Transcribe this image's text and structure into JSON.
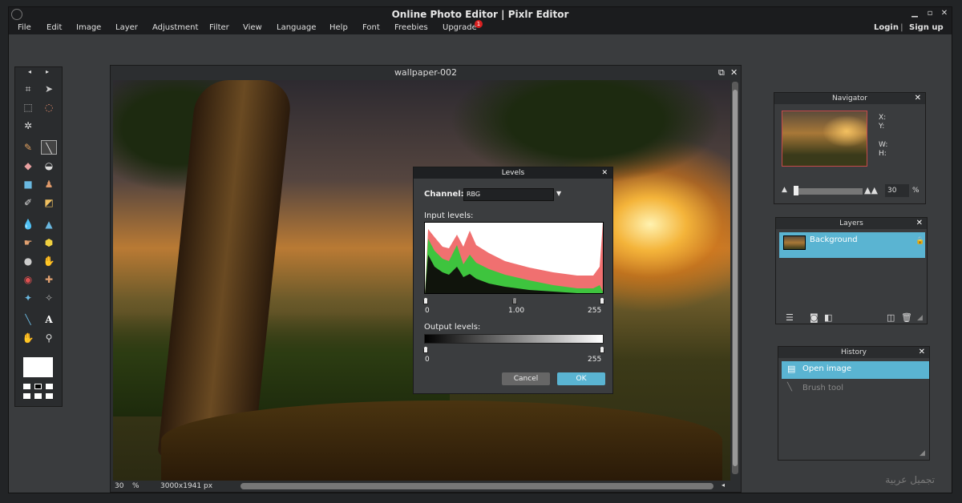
{
  "window": {
    "title": "Online Photo Editor | Pixlr Editor"
  },
  "menu": {
    "items": [
      "File",
      "Edit",
      "Image",
      "Layer",
      "Adjustment",
      "Filter",
      "View",
      "Language",
      "Help",
      "Font",
      "Freebies",
      "Upgrade"
    ],
    "upgrade_badge": "1",
    "login": "Login",
    "separator": "|",
    "signup": "Sign up"
  },
  "toolbox": {
    "prev": "◂",
    "next": "▸"
  },
  "document": {
    "title": "wallpaper-002",
    "zoom": "30",
    "zoom_unit": "%",
    "dimensions": "3000x1941 px"
  },
  "levels": {
    "title": "Levels",
    "channel_label": "Channel:",
    "channel_value": "RBG",
    "input_label": "Input levels:",
    "input_min": "0",
    "input_gamma": "1.00",
    "input_max": "255",
    "output_label": "Output levels:",
    "output_min": "0",
    "output_max": "255",
    "cancel": "Cancel",
    "ok": "OK"
  },
  "navigator": {
    "title": "Navigator",
    "x_label": "X:",
    "y_label": "Y:",
    "w_label": "W:",
    "h_label": "H:",
    "zoom": "30",
    "zoom_unit": "%"
  },
  "layers": {
    "title": "Layers",
    "items": [
      {
        "name": "Background"
      }
    ]
  },
  "history": {
    "title": "History",
    "items": [
      {
        "name": "Open image"
      },
      {
        "name": "Brush tool"
      }
    ]
  },
  "watermark": "تجميل عربية",
  "colors": {
    "accent": "#5ab4d2",
    "hist_red": "#f07070",
    "hist_green": "#3ec43e"
  }
}
